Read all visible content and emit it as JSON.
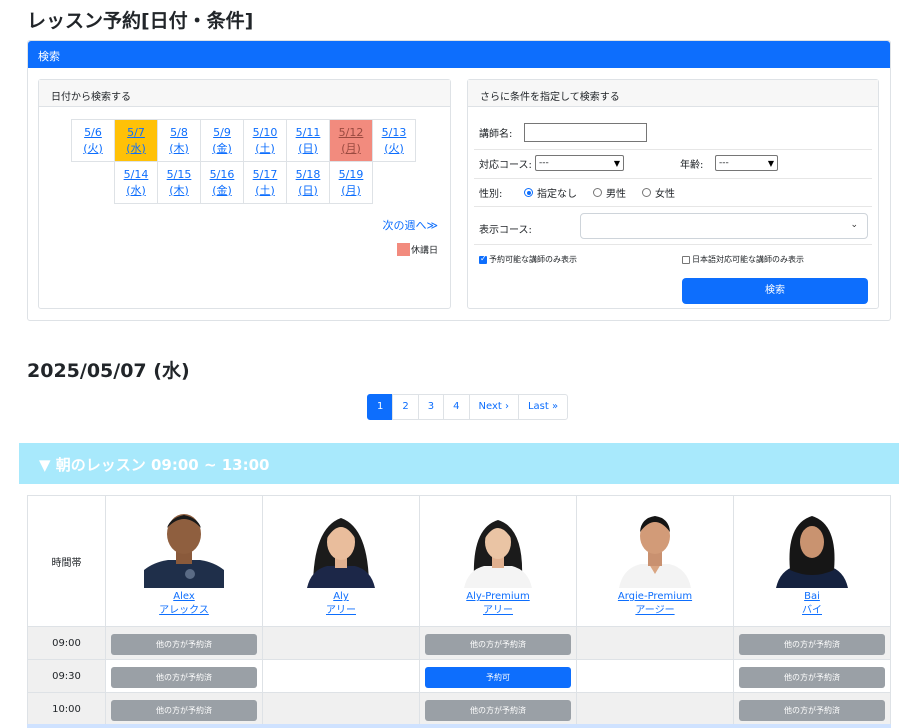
{
  "page_title": "レッスン予約[日付・条件]",
  "search_card": {
    "header": "検索",
    "date_panel": {
      "header": "日付から検索する",
      "row1": [
        {
          "day": "5/6",
          "dow": "(火)",
          "state": "normal"
        },
        {
          "day": "5/7",
          "dow": "(水)",
          "state": "selected"
        },
        {
          "day": "5/8",
          "dow": "(木)",
          "state": "normal"
        },
        {
          "day": "5/9",
          "dow": "(金)",
          "state": "normal"
        },
        {
          "day": "5/10",
          "dow": "(土)",
          "state": "normal"
        },
        {
          "day": "5/11",
          "dow": "(日)",
          "state": "normal"
        },
        {
          "day": "5/12",
          "dow": "(月)",
          "state": "holiday"
        },
        {
          "day": "5/13",
          "dow": "(火)",
          "state": "normal"
        }
      ],
      "row2": [
        {
          "day": "5/14",
          "dow": "(水)",
          "state": "normal"
        },
        {
          "day": "5/15",
          "dow": "(木)",
          "state": "normal"
        },
        {
          "day": "5/16",
          "dow": "(金)",
          "state": "normal"
        },
        {
          "day": "5/17",
          "dow": "(土)",
          "state": "normal"
        },
        {
          "day": "5/18",
          "dow": "(日)",
          "state": "normal"
        },
        {
          "day": "5/19",
          "dow": "(月)",
          "state": "normal"
        }
      ],
      "next_week": "次の週へ≫",
      "legend_label": "休講日"
    },
    "cond_panel": {
      "header": "さらに条件を指定して検索する",
      "teacher_label": "講師名:",
      "teacher_value": "",
      "course_label": "対応コース:",
      "course_value": "---",
      "age_label": "年齢:",
      "age_value": "---",
      "gender_label": "性別:",
      "gender_options": [
        "指定なし",
        "男性",
        "女性"
      ],
      "gender_selected": "指定なし",
      "display_course_label": "表示コース:",
      "display_course_value": "",
      "only_available_label": "予約可能な講師のみ表示",
      "only_available_checked": true,
      "only_japanese_label": "日本語対応可能な講師のみ表示",
      "only_japanese_checked": false,
      "search_button": "検索"
    }
  },
  "date_heading": "2025/05/07 (水)",
  "pagination": {
    "pages": [
      "1",
      "2",
      "3",
      "4"
    ],
    "active": "1",
    "next": "Next ›",
    "last": "Last »"
  },
  "session_banner": "▼ 朝のレッスン 09:00 ~ 13:00",
  "schedule": {
    "time_header": "時間帯",
    "teachers": [
      {
        "name": "Alex",
        "kana": "アレックス"
      },
      {
        "name": "Aly",
        "kana": "アリー"
      },
      {
        "name": "Aly-Premium",
        "kana": "アリー"
      },
      {
        "name": "Argie-Premium",
        "kana": "アージー"
      },
      {
        "name": "Bai",
        "kana": "バイ"
      }
    ],
    "booked_label": "他の方が予約済",
    "open_label": "予約可",
    "rows": [
      {
        "time": "09:00",
        "slots": [
          "booked",
          "",
          "booked",
          "",
          "booked"
        ]
      },
      {
        "time": "09:30",
        "slots": [
          "booked",
          "",
          "open",
          "",
          "booked"
        ]
      },
      {
        "time": "10:00",
        "slots": [
          "booked",
          "",
          "booked",
          "",
          "booked"
        ]
      }
    ]
  },
  "colors": {
    "primary": "#0d6efd",
    "selected_day": "#ffc107",
    "holiday": "#f28b7e",
    "banner": "#a8e9fc",
    "booked": "#9aa0a6"
  }
}
